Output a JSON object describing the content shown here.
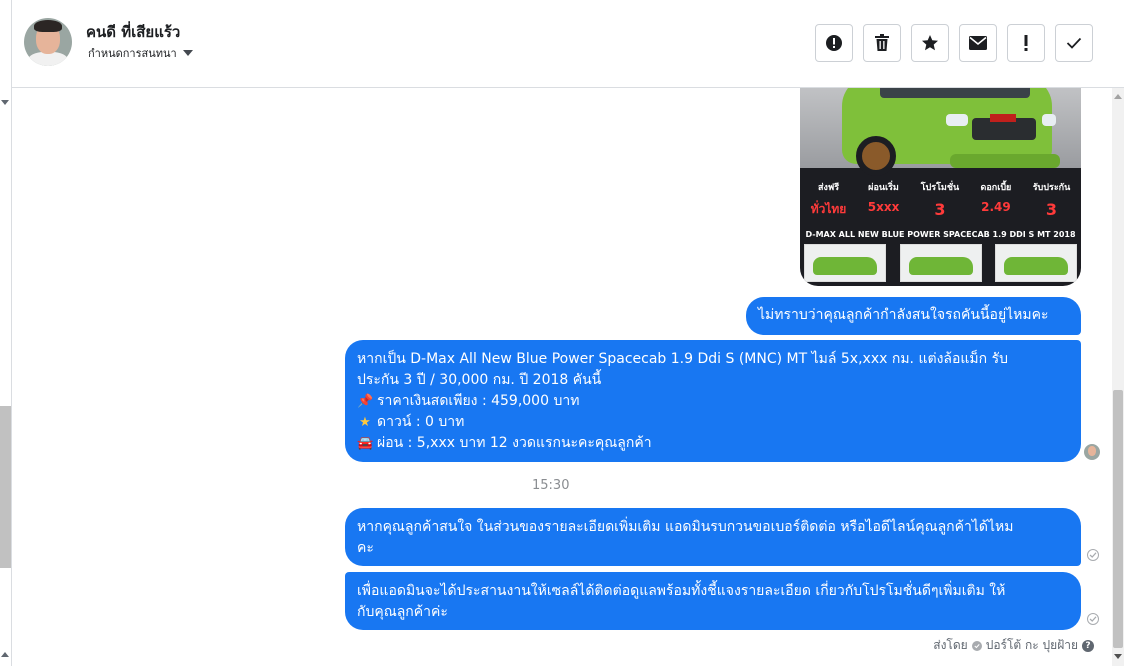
{
  "header": {
    "contact_name": "คนดี ที่เสียแร้ว",
    "conversation_label": "กำหนดการสนทนา"
  },
  "car_ad": {
    "promos": [
      {
        "label": "ส่งฟรี",
        "value": "ทั่วไทย"
      },
      {
        "label": "ผ่อนเริ่ม",
        "value": "5xxx"
      },
      {
        "label": "โปรโมชั่น",
        "value": "3"
      },
      {
        "label": "ดอกเบี้ย",
        "value": "2.49"
      },
      {
        "label": "รับประกัน",
        "value": "3"
      }
    ],
    "caption": "D-MAX ALL NEW BLUE POWER SPACECAB 1.9 DDI S MT 2018"
  },
  "messages": [
    {
      "lines": [
        "ไม่ทราบว่าคุณลูกค้ากำลังสนใจรถคันนี้อยู่ไหมคะ"
      ]
    },
    {
      "lines": [
        "หากเป็น  D-Max All New Blue Power Spacecab 1.9 Ddi S (MNC) MT ไมล์ 5x,xxx กม. แต่งล้อแม็ก รับ",
        "ประกัน 3 ปี / 30,000 กม. ปี 2018 คันนี้",
        "ราคาเงินสดเพียง : 459,000 บาท",
        "ดาวน์ : 0 บาท",
        "ผ่อน : 5,xxx บาท 12 งวดแรกนะคะคุณลูกค้า"
      ]
    },
    {
      "lines": [
        "หากคุณลูกค้าสนใจ ในส่วนของรายละเอียดเพิ่มเติม แอดมินรบกวนขอเบอร์ติดต่อ หรือไอดีไลน์คุณลูกค้าได้ไหม",
        "คะ"
      ]
    },
    {
      "lines": [
        "เพื่อแอดมินจะได้ประสานงานให้เซลล์ได้ติดต่อดูแลพร้อมทั้งชี้แจงรายละเอียด เกี่ยวกับโปรโมชั่นดีๆเพิ่มเติม ให้",
        "กับคุณลูกค้าค่ะ"
      ]
    }
  ],
  "time_divider": "15:30",
  "sent_by": {
    "prefix": "ส่งโดย",
    "name": "ปอร์โต้ กะ ปุยฝ้าย"
  },
  "icons": {
    "b2_line3": "pushpin-icon",
    "b2_line4": "star-icon",
    "b2_line5": "car-icon"
  },
  "colors": {
    "bubble": "#1877f2",
    "border": "#dadde1"
  }
}
